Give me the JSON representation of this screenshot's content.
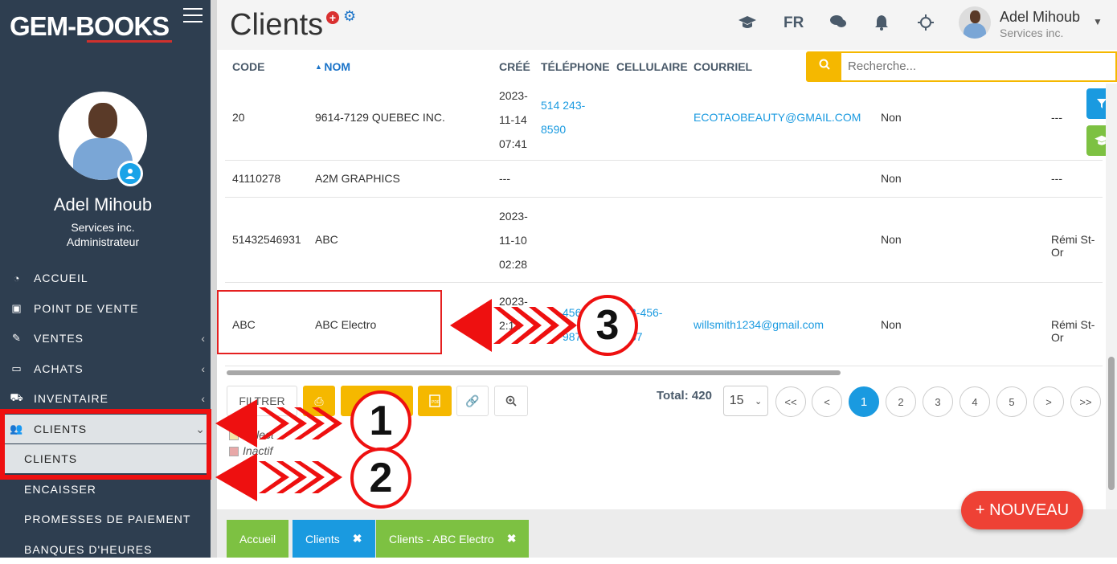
{
  "sidebar": {
    "logo": "GEM-BOOKS",
    "user": {
      "name": "Adel Mihoub",
      "company": "Services inc.",
      "role": "Administrateur"
    },
    "items": [
      {
        "label": "ACCUEIL",
        "icon": "dashboard-icon"
      },
      {
        "label": "POINT DE VENTE",
        "icon": "cash-icon"
      },
      {
        "label": "VENTES",
        "icon": "edit-icon"
      },
      {
        "label": "ACHATS",
        "icon": "credit-card-icon"
      },
      {
        "label": "INVENTAIRE",
        "icon": "cart-icon"
      },
      {
        "label": "CLIENTS",
        "icon": "users-icon"
      }
    ],
    "sub_items": [
      {
        "label": "CLIENTS"
      },
      {
        "label": "ENCAISSER"
      },
      {
        "label": "PROMESSES DE PAIEMENT"
      },
      {
        "label": "BANQUES D'HEURES"
      }
    ]
  },
  "header": {
    "title": "Clients",
    "lang": "FR",
    "user_name": "Adel Mihoub",
    "user_company": "Services inc."
  },
  "table": {
    "columns": [
      "CODE",
      "NOM",
      "CRÉÉ",
      "TÉLÉPHONE",
      "CELLULAIRE",
      "COURRIEL"
    ],
    "search_placeholder": "Recherche...",
    "rows": [
      {
        "code": "20",
        "nom": "9614-7129 QUEBEC INC.",
        "cree": [
          "2023-",
          "11-14",
          "07:41"
        ],
        "telephone": [
          "514 243-",
          "8590"
        ],
        "cellulaire": [],
        "courriel": "ECOTAOBEAUTY@GMAIL.COM",
        "actif": "Non",
        "extra": "---"
      },
      {
        "code": "41110278",
        "nom": "A2M GRAPHICS",
        "cree": [
          "---"
        ],
        "telephone": [],
        "cellulaire": [],
        "courriel": "",
        "actif": "Non",
        "extra": "---"
      },
      {
        "code": "51432546931",
        "nom": "ABC",
        "cree": [
          "2023-",
          "11-10",
          "02:28"
        ],
        "telephone": [],
        "cellulaire": [],
        "courriel": "",
        "actif": "Non",
        "extra": "Rémi St-Or"
      },
      {
        "code": "ABC",
        "nom": "ABC Electro",
        "cree": [
          "2023-",
          "",
          "2:14"
        ],
        "telephone": [
          "456-",
          "987"
        ],
        "cellulaire": [
          "3-456-",
          "87"
        ],
        "courriel": "willsmith1234@gmail.com",
        "actif": "Non",
        "extra": "Rémi St-Or"
      }
    ]
  },
  "toolbar": {
    "filter_label": "FILTRER",
    "total": "Total: 420",
    "per_page": "15",
    "pages": [
      "<<",
      "<",
      "1",
      "2",
      "3",
      "4",
      "5",
      ">",
      ">>"
    ],
    "legend": [
      "Sélect",
      "Inactif"
    ]
  },
  "footer": {
    "tabs": [
      "Accueil",
      "Clients",
      "Clients - ABC Electro"
    ],
    "new_button": "+ NOUVEAU"
  },
  "annotations": [
    "1",
    "2",
    "3"
  ],
  "colors": {
    "accent": "#1a9ae0",
    "annotation": "#ee1010",
    "warning": "#f5b800",
    "success": "#7dc142"
  }
}
